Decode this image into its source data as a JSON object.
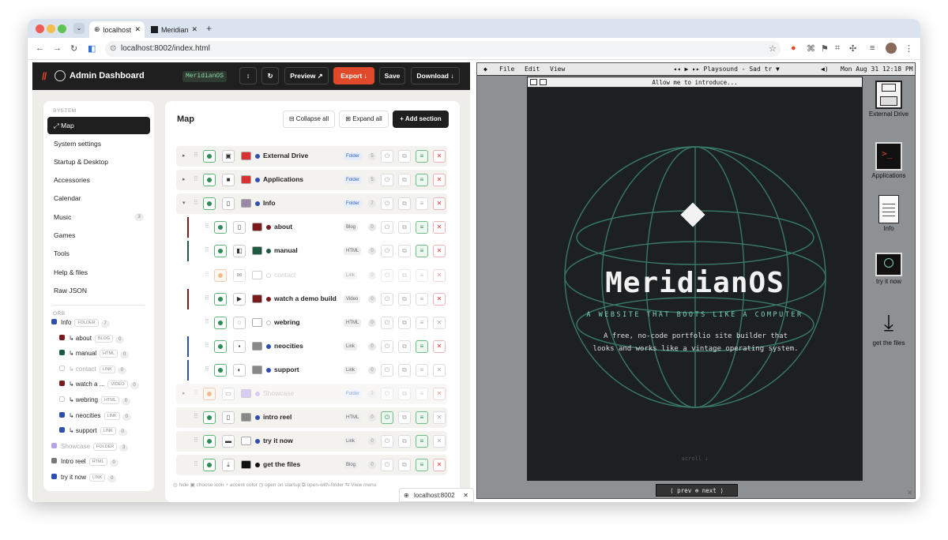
{
  "browser": {
    "tabs": [
      {
        "label": "localhost"
      },
      {
        "label": "Meridian"
      }
    ],
    "url": "localhost:8002/index.html",
    "status_url": "localhost:8002"
  },
  "admin": {
    "title": "Admin Dashboard",
    "os_badge": "MeridianOS",
    "buttons": {
      "updown": "↕",
      "refresh": "↻",
      "preview": "Preview ↗",
      "export": "Export ↓",
      "save": "Save",
      "download": "Download ↓"
    },
    "sidebar": {
      "section_system": "SYSTEM",
      "items": [
        {
          "label": "⤢ Map"
        },
        {
          "label": "System settings"
        },
        {
          "label": "Startup & Desktop"
        },
        {
          "label": "Accessories"
        },
        {
          "label": "Calendar"
        },
        {
          "label": "Music",
          "count": "3"
        },
        {
          "label": "Games"
        },
        {
          "label": "Tools"
        },
        {
          "label": "Help & files"
        },
        {
          "label": "Raw JSON"
        }
      ],
      "section_orb": "ORB",
      "orbs": [
        {
          "label": "Info",
          "tag": "FOLDER",
          "n": "7",
          "color": "#2f4fb0"
        },
        {
          "label": "↳ about",
          "tag": "BLOG",
          "n": "0",
          "color": "#7a1a1a"
        },
        {
          "label": "↳ manual",
          "tag": "HTML",
          "n": "0",
          "color": "#1e5a3f"
        },
        {
          "label": "↳ contact",
          "tag": "LINK",
          "n": "0",
          "color": "#ffffff"
        },
        {
          "label": "↳ watch a ...",
          "tag": "VIDEO",
          "n": "0",
          "color": "#7a1a1a"
        },
        {
          "label": "↳ webring",
          "tag": "HTML",
          "n": "0",
          "color": "#ffffff"
        },
        {
          "label": "↳ neocities",
          "tag": "LINK",
          "n": "0",
          "color": "#2f4fb0"
        },
        {
          "label": "↳ support",
          "tag": "LINK",
          "n": "0",
          "color": "#2f4fb0"
        },
        {
          "label": "Showcase",
          "tag": "FOLDER",
          "n": "3",
          "color": "#b5a5e8"
        },
        {
          "label": "Intro reel",
          "tag": "HTML",
          "n": "0",
          "color": "#777777"
        },
        {
          "label": "try it now",
          "tag": "LINK",
          "n": "0",
          "color": "#2f4fb0"
        }
      ]
    },
    "map": {
      "title": "Map",
      "collapse": "⊟ Collapse all",
      "expand": "⊞ Expand all",
      "add": "+ Add section",
      "rows": [
        {
          "name": "External Drive",
          "tag": "Folder",
          "n": "5",
          "swatch": "#d93030",
          "dot": "#2f4fb0",
          "icon": "▣"
        },
        {
          "name": "Applications",
          "tag": "Folder",
          "n": "5",
          "swatch": "#d93030",
          "dot": "#2f4fb0",
          "icon": "■"
        },
        {
          "name": "Info",
          "tag": "Folder",
          "n": "7",
          "swatch": "#9a8aa8",
          "dot": "#2f4fb0",
          "icon": "▯"
        },
        {
          "name": "about",
          "tag": "Blog",
          "n": "0",
          "swatch": "#7a1a1a",
          "dot": "#7a1a1a",
          "icon": "▯"
        },
        {
          "name": "manual",
          "tag": "HTML",
          "n": "0",
          "swatch": "#1e5a3f",
          "dot": "#1e5a3f",
          "icon": "◧"
        },
        {
          "name": "contact",
          "tag": "Link",
          "n": "0",
          "swatch": "#ffffff",
          "dot": "#ffffff",
          "icon": "✉"
        },
        {
          "name": "watch a demo build",
          "tag": "Video",
          "n": "0",
          "swatch": "#7a1a1a",
          "dot": "#7a1a1a",
          "icon": "▶"
        },
        {
          "name": "webring",
          "tag": "HTML",
          "n": "0",
          "swatch": "#ffffff",
          "dot": "#ffffff",
          "icon": "◌"
        },
        {
          "name": "neocities",
          "tag": "Link",
          "n": "0",
          "swatch": "#888888",
          "dot": "#2f4fb0",
          "icon": "▪"
        },
        {
          "name": "support",
          "tag": "Link",
          "n": "0",
          "swatch": "#888888",
          "dot": "#2f4fb0",
          "icon": "◐"
        },
        {
          "name": "Showcase",
          "tag": "Folder",
          "n": "3",
          "swatch": "#b5a5e8",
          "dot": "#b5a5e8",
          "icon": "▭"
        },
        {
          "name": "intro reel",
          "tag": "HTML",
          "n": "0",
          "swatch": "#888888",
          "dot": "#2f4fb0",
          "icon": "▯"
        },
        {
          "name": "try it now",
          "tag": "Link",
          "n": "0",
          "swatch": "#ffffff",
          "dot": "#2f4fb0",
          "icon": "▬"
        },
        {
          "name": "get the files",
          "tag": "Blog",
          "n": "0",
          "swatch": "#111111",
          "dot": "#111111",
          "icon": "⤓"
        }
      ],
      "legend": "◎ hide    ▣ choose icon    ◔ accent color    ◷ open on startup    ⧉ open-with-folder    ⇆ View menu"
    }
  },
  "desktop": {
    "menu": {
      "apple": "◆",
      "file": "File",
      "edit": "Edit",
      "view": "View",
      "player": "◂◂ ▶ ▸▸  Playsound - Sad tr ▼",
      "volume": "◀)",
      "clock": "Mon Aug 31 12:18 PM"
    },
    "window_title": "Allow me to introduce...",
    "brand": "MeridianOS",
    "tagline": "A WEBSITE THAT BOOTS LIKE A COMPUTER",
    "description": "A free, no-code portfolio site builder that looks and works like a vintage operating system.",
    "scroll": "scroll ↓",
    "nav": "⟨ prev ⊕ next ⟩",
    "icons": [
      {
        "label": "External Drive"
      },
      {
        "label": "Applications"
      },
      {
        "label": "Info"
      },
      {
        "label": "try it now"
      },
      {
        "label": "get the files"
      }
    ]
  }
}
